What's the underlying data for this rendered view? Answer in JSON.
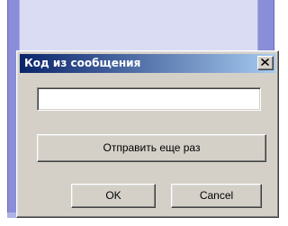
{
  "dialog": {
    "title": "Код из сообщения",
    "code_value": "",
    "resend_label": "Отправить еще раз",
    "ok_label": "OK",
    "cancel_label": "Cancel"
  },
  "icons": {
    "close": "close-icon"
  },
  "colors": {
    "titlebar_start": "#0a246a",
    "titlebar_end": "#a6caf0",
    "dialog_face": "#d4d0c8",
    "background_window": "#8a8ed8"
  }
}
